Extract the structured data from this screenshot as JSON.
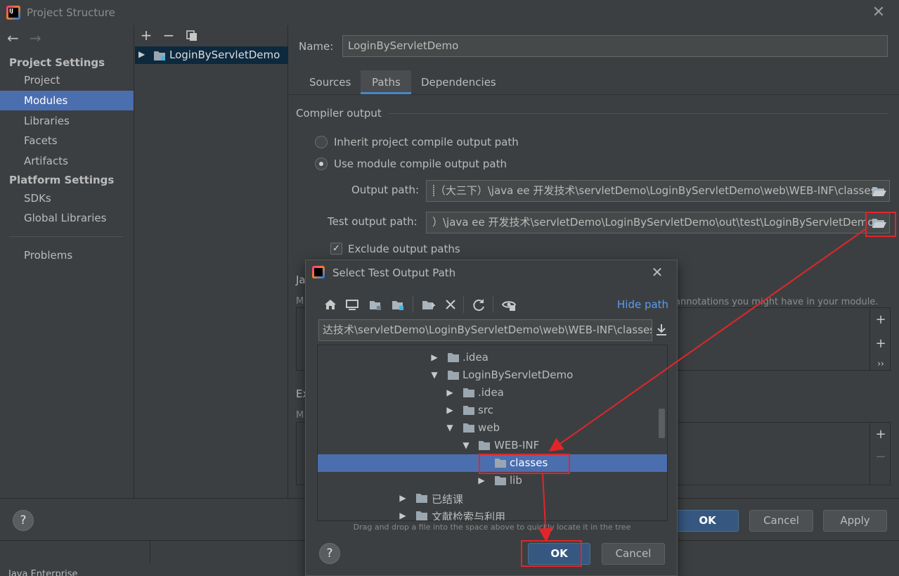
{
  "window": {
    "title": "Project Structure"
  },
  "sidebar": {
    "project_settings": "Project Settings",
    "platform_settings": "Platform Settings",
    "items": [
      {
        "label": "Project"
      },
      {
        "label": "Modules"
      },
      {
        "label": "Libraries"
      },
      {
        "label": "Facets"
      },
      {
        "label": "Artifacts"
      },
      {
        "label": "SDKs"
      },
      {
        "label": "Global Libraries"
      },
      {
        "label": "Problems"
      }
    ]
  },
  "modules": {
    "name": "LoginByServletDemo"
  },
  "main": {
    "name_label": "Name:",
    "name_value": "LoginByServletDemo",
    "tabs": [
      {
        "label": "Sources"
      },
      {
        "label": "Paths"
      },
      {
        "label": "Dependencies"
      }
    ],
    "compiler_output": "Compiler output",
    "radio_inherit": "Inherit project compile output path",
    "radio_module": "Use module compile output path",
    "output_label": "Output path:",
    "output_value": "⸽（大三下）\\java ee 开发技术\\servletDemo\\LoginByServletDemo\\web\\WEB-INF\\classes",
    "test_label": "Test output path:",
    "test_value": "）\\java ee 开发技术\\servletDemo\\LoginByServletDemo\\out\\test\\LoginByServletDemo",
    "exclude_label": "Exclude output paths",
    "ja_stub": "Ja",
    "m_stub": "M",
    "annotations_text": "annotations you might have in your module.",
    "ex_stub": "Ex",
    "m2_stub": "M"
  },
  "bottom": {
    "help": "?",
    "ok": "OK",
    "cancel": "Cancel",
    "apply": "Apply"
  },
  "status": {
    "text": "Java Enterprise"
  },
  "dialog": {
    "title": "Select Test Output Path",
    "hide_path": "Hide path",
    "path_value": "达技术\\servletDemo\\LoginByServletDemo\\web\\WEB-INF\\classes",
    "tree": [
      {
        "label": ".idea"
      },
      {
        "label": "LoginByServletDemo"
      },
      {
        "label": ".idea"
      },
      {
        "label": "src"
      },
      {
        "label": "web"
      },
      {
        "label": "WEB-INF"
      },
      {
        "label": "classes"
      },
      {
        "label": "lib"
      },
      {
        "label": "已结课"
      },
      {
        "label": "文献检索与利用"
      }
    ],
    "hint": "Drag and drop a file into the space above to quickly locate it in the tree",
    "help": "?",
    "ok": "OK",
    "cancel": "Cancel"
  },
  "colors": {
    "accent": "#4b6eaf",
    "annotation_red": "#e0262b",
    "link": "#589df6"
  }
}
